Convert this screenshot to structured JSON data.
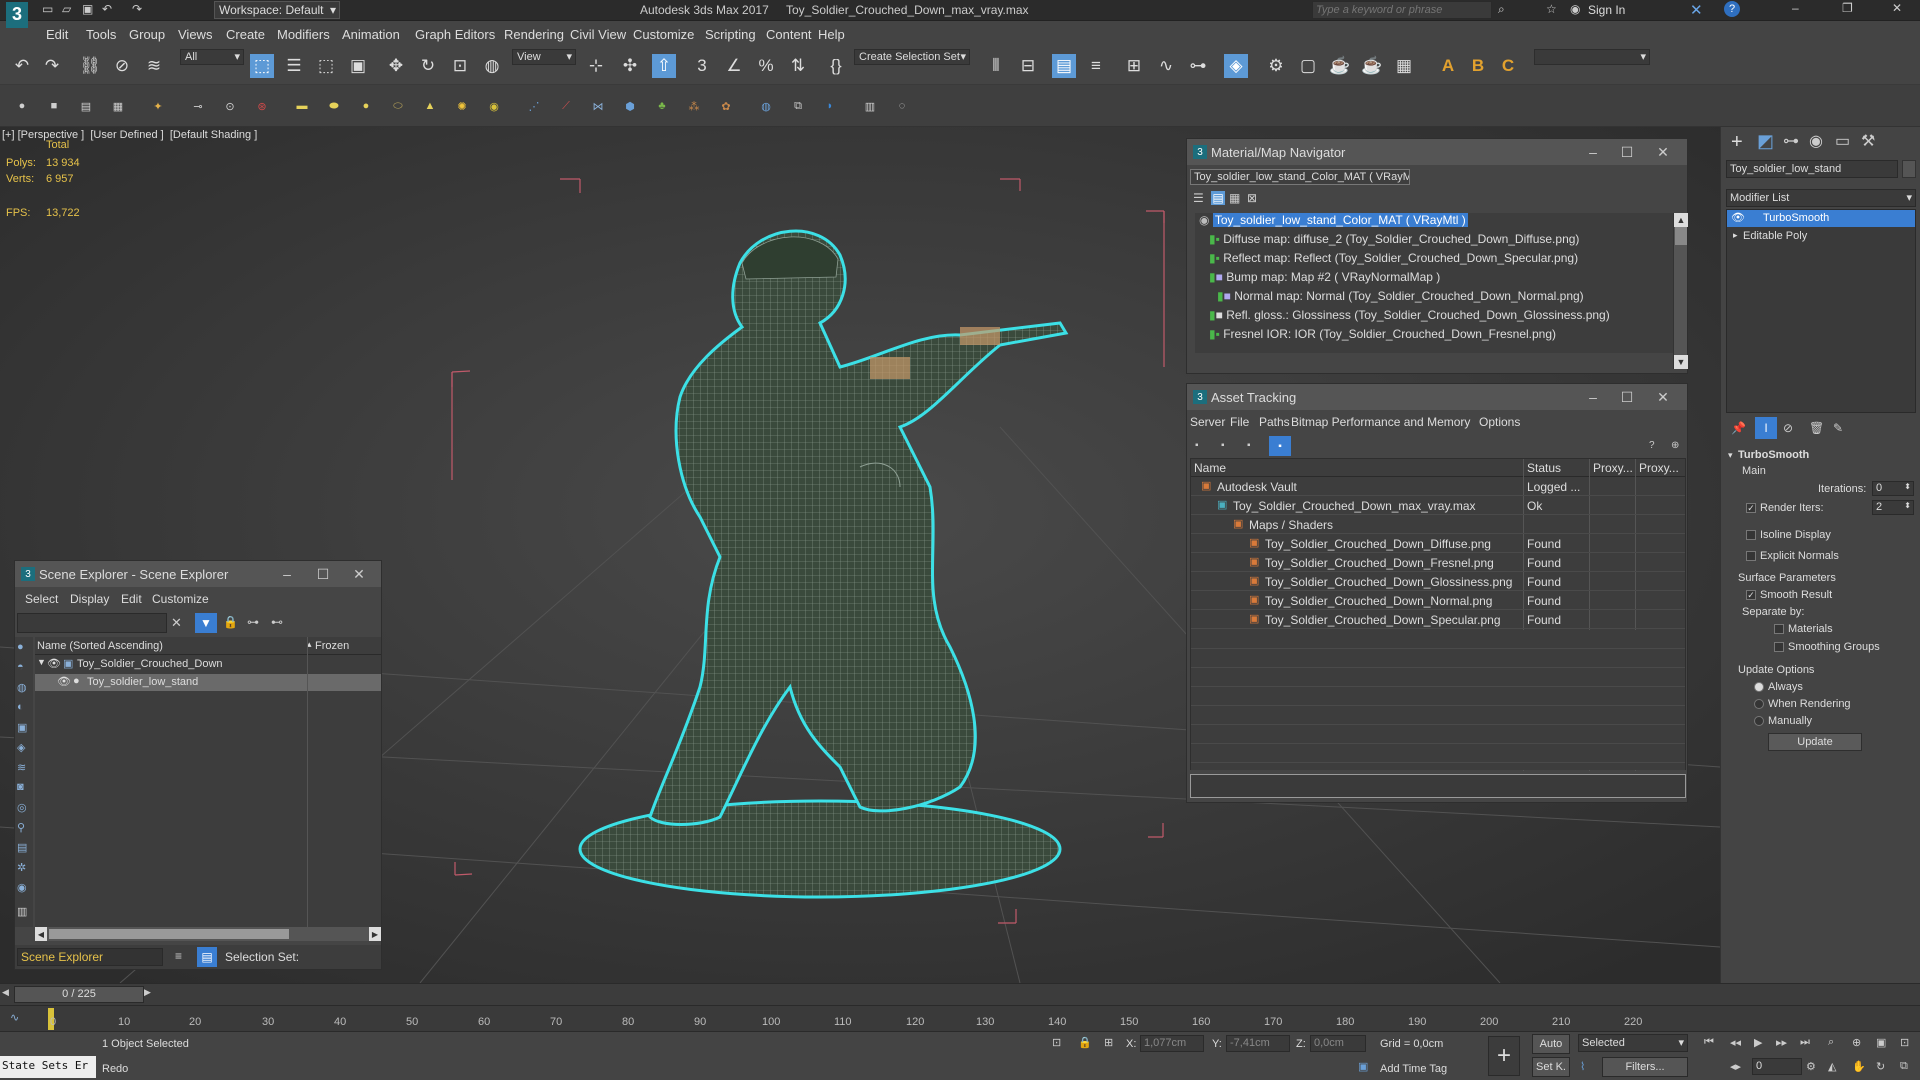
{
  "titlebar": {
    "workspace": "Workspace: Default",
    "app_title": "Autodesk 3ds Max 2017",
    "file_title": "Toy_Soldier_Crouched_Down_max_vray.max",
    "search_placeholder": "Type a keyword or phrase",
    "sign_in": "Sign In"
  },
  "menu": [
    "Edit",
    "Tools",
    "Group",
    "Views",
    "Create",
    "Modifiers",
    "Animation",
    "Graph Editors",
    "Rendering",
    "Civil View",
    "Customize",
    "Scripting",
    "Content",
    "Help"
  ],
  "toolbar": {
    "filter": "All",
    "view_dropdown": "View",
    "selection_set": "Create Selection Set"
  },
  "viewport": {
    "label": "[+] [Perspective ]  [User Defined ]  [Default Shading ]",
    "stats_header": "Total",
    "polys_label": "Polys:",
    "polys_value": "13 934",
    "verts_label": "Verts:",
    "verts_value": "6 957",
    "fps_label": "FPS:",
    "fps_value": "13,722"
  },
  "mat_nav": {
    "title": "Material/Map Navigator",
    "field": "Toy_soldier_low_stand_Color_MAT  ( VRayMtl )",
    "items": [
      "Toy_soldier_low_stand_Color_MAT  ( VRayMtl )",
      "Diffuse map: diffuse_2 (Toy_Soldier_Crouched_Down_Diffuse.png)",
      "Reflect map: Reflect (Toy_Soldier_Crouched_Down_Specular.png)",
      "Bump map: Map #2  ( VRayNormalMap )",
      "Normal map: Normal (Toy_Soldier_Crouched_Down_Normal.png)",
      "Refl. gloss.: Glossiness (Toy_Soldier_Crouched_Down_Glossiness.png)",
      "Fresnel IOR: IOR (Toy_Soldier_Crouched_Down_Fresnel.png)"
    ]
  },
  "asset": {
    "title": "Asset Tracking",
    "menu": [
      "Server",
      "File",
      "Paths",
      "Bitmap Performance and Memory",
      "Options"
    ],
    "columns": [
      "Name",
      "Status",
      "Proxy...",
      "Proxy..."
    ],
    "rows": [
      {
        "name": "Autodesk Vault",
        "status": "Logged ..."
      },
      {
        "name": "Toy_Soldier_Crouched_Down_max_vray.max",
        "status": "Ok"
      },
      {
        "name": "Maps / Shaders",
        "status": ""
      },
      {
        "name": "Toy_Soldier_Crouched_Down_Diffuse.png",
        "status": "Found"
      },
      {
        "name": "Toy_Soldier_Crouched_Down_Fresnel.png",
        "status": "Found"
      },
      {
        "name": "Toy_Soldier_Crouched_Down_Glossiness.png",
        "status": "Found"
      },
      {
        "name": "Toy_Soldier_Crouched_Down_Normal.png",
        "status": "Found"
      },
      {
        "name": "Toy_Soldier_Crouched_Down_Specular.png",
        "status": "Found"
      }
    ]
  },
  "scene_explorer": {
    "title": "Scene Explorer - Scene Explorer",
    "menu": [
      "Select",
      "Display",
      "Edit",
      "Customize"
    ],
    "col_name": "Name (Sorted Ascending)",
    "col_frozen": "Frozen",
    "items": [
      "Toy_Soldier_Crouched_Down",
      "Toy_soldier_low_stand"
    ],
    "footer_label": "Scene Explorer",
    "selection_set": "Selection Set:"
  },
  "cmd": {
    "object_name": "Toy_soldier_low_stand",
    "modifier_list": "Modifier List",
    "stack": [
      "TurboSmooth",
      "Editable Poly"
    ],
    "rollout": "TurboSmooth",
    "main": "Main",
    "iterations_label": "Iterations:",
    "iterations": "0",
    "render_iters_label": "Render Iters:",
    "render_iters": "2",
    "isoline": "Isoline Display",
    "explicit": "Explicit Normals",
    "surface": "Surface Parameters",
    "smooth_result": "Smooth Result",
    "separate_by": "Separate by:",
    "materials": "Materials",
    "smoothing_groups": "Smoothing Groups",
    "update_options": "Update Options",
    "always": "Always",
    "when_rendering": "When Rendering",
    "manually": "Manually",
    "update_btn": "Update"
  },
  "timeline": {
    "frame": "0 / 225",
    "ticks": [
      "0",
      "10",
      "20",
      "30",
      "40",
      "50",
      "60",
      "70",
      "80",
      "90",
      "100",
      "110",
      "120",
      "130",
      "140",
      "150",
      "160",
      "170",
      "180",
      "190",
      "200",
      "210",
      "220"
    ]
  },
  "status": {
    "maxscript": "State Sets Er",
    "selected": "1 Object Selected",
    "prompt": "Redo",
    "x_label": "X:",
    "x": "1,077cm",
    "y_label": "Y:",
    "y": "-7,41cm",
    "z_label": "Z:",
    "z": "0,0cm",
    "grid": "Grid = 0,0cm",
    "add_time_tag": "Add Time Tag",
    "auto": "Auto",
    "set_k": "Set K.",
    "selected_dd": "Selected",
    "filters": "Filters...",
    "frame_field": "0"
  }
}
